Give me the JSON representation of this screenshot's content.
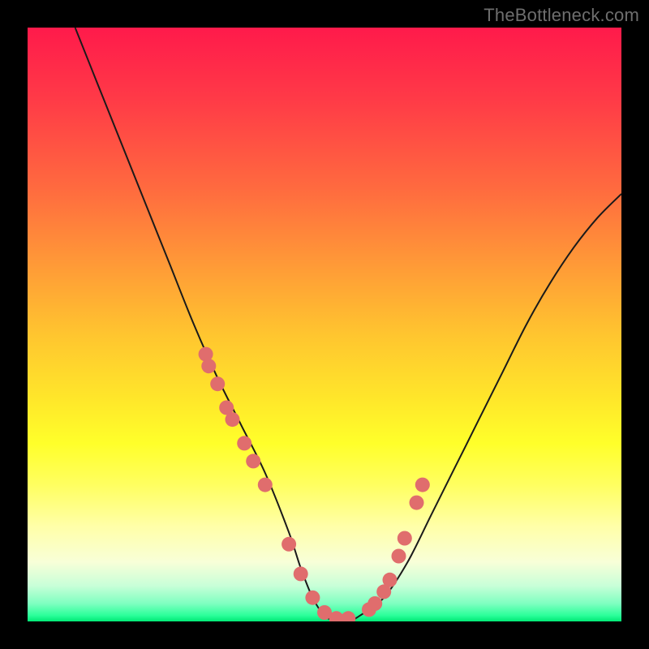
{
  "watermark": "TheBottleneck.com",
  "colors": {
    "frame": "#000000",
    "gradient_top": "#ff1a4b",
    "gradient_bottom": "#00e876",
    "curve": "#1a1a1a",
    "marker": "#e06d6d"
  },
  "chart_data": {
    "type": "line",
    "title": "",
    "xlabel": "",
    "ylabel": "",
    "xlim": [
      0,
      100
    ],
    "ylim": [
      0,
      100
    ],
    "grid": false,
    "legend": false,
    "series": [
      {
        "name": "bottleneck-curve",
        "x": [
          8,
          12,
          16,
          20,
          24,
          28,
          32,
          36,
          40,
          44,
          46,
          48,
          50,
          52,
          54,
          56,
          60,
          64,
          68,
          72,
          76,
          80,
          84,
          88,
          92,
          96,
          100
        ],
        "y": [
          100,
          90,
          80,
          70,
          60,
          50,
          41,
          33,
          25,
          15,
          9,
          4,
          1,
          0,
          0,
          1,
          4,
          10,
          18,
          26,
          34,
          42,
          50,
          57,
          63,
          68,
          72
        ]
      }
    ],
    "markers": {
      "name": "highlight-points",
      "x": [
        30.0,
        30.5,
        32.0,
        33.5,
        34.5,
        36.5,
        38.0,
        40.0,
        44.0,
        46.0,
        48.0,
        50.0,
        52.0,
        54.0,
        57.5,
        58.5,
        60.0,
        61.0,
        62.5,
        63.5,
        65.5,
        66.5
      ],
      "y": [
        45,
        43,
        40,
        36,
        34,
        30,
        27,
        23,
        13,
        8,
        4,
        1.5,
        0.5,
        0.5,
        2,
        3,
        5,
        7,
        11,
        14,
        20,
        23
      ]
    }
  }
}
